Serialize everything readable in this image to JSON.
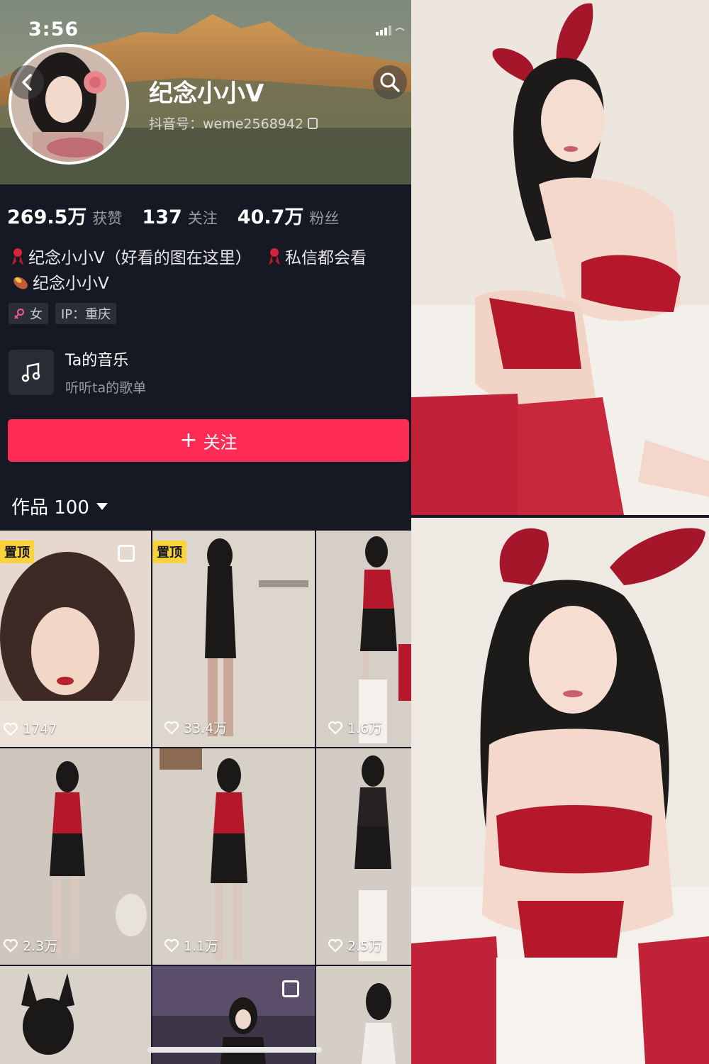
{
  "status_bar": {
    "time": "3:56"
  },
  "profile": {
    "username": "纪念小小V",
    "douyin_id": "抖音号：weme2568942",
    "stats": [
      {
        "value": "269.5万",
        "label": "获赞"
      },
      {
        "value": "137",
        "label": "关注"
      },
      {
        "value": "40.7万",
        "label": "粉丝"
      }
    ],
    "bio_line1_a": "纪念小小V（好看的图在这里）",
    "bio_line1_b": "私信都会看",
    "bio_line2": "纪念小小V",
    "tags": {
      "gender": "女",
      "ip": "IP：重庆"
    },
    "music": {
      "title": "Ta的音乐",
      "subtitle": "听听ta的歌单"
    },
    "follow_label": "关注",
    "works_label": "作品 100"
  },
  "grid": [
    {
      "pinned": true,
      "pin_label": "置顶",
      "multi": true,
      "likes": "1747"
    },
    {
      "pinned": true,
      "pin_label": "置顶",
      "multi": false,
      "likes": "33.4万"
    },
    {
      "pinned": false,
      "multi": false,
      "likes": "1.6万"
    },
    {
      "pinned": false,
      "multi": false,
      "likes": "2.3万"
    },
    {
      "pinned": false,
      "multi": false,
      "likes": "1.1万"
    },
    {
      "pinned": false,
      "multi": false,
      "likes": "2.5万"
    },
    {
      "pinned": false,
      "multi": false,
      "likes": ""
    },
    {
      "pinned": false,
      "multi": true,
      "likes": ""
    },
    {
      "pinned": false,
      "multi": false,
      "likes": ""
    }
  ],
  "colors": {
    "background": "#161823",
    "follow_button": "#fe2c55",
    "pin_badge": "#f9d33b",
    "lingerie_red": "#b5182a"
  },
  "icons": [
    "back-arrow-icon",
    "search-icon",
    "signal-icon",
    "copy-icon",
    "ribbon-icon",
    "sweet-potato-icon",
    "female-icon",
    "music-note-icon",
    "plus-icon",
    "caret-down-icon",
    "heart-icon",
    "multi-image-icon"
  ]
}
